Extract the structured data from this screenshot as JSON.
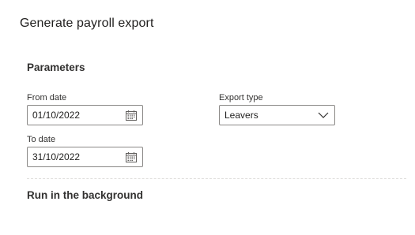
{
  "dialog": {
    "title": "Generate payroll export"
  },
  "parameters": {
    "section_title": "Parameters",
    "from_date": {
      "label": "From date",
      "value": "01/10/2022",
      "icon": "calendar-icon"
    },
    "to_date": {
      "label": "To date",
      "value": "31/10/2022",
      "icon": "calendar-icon"
    },
    "export_type": {
      "label": "Export type",
      "value": "Leavers",
      "icon": "chevron-down-icon"
    }
  },
  "background": {
    "section_title": "Run in the background"
  },
  "colors": {
    "border": "#8a8886",
    "text": "#201f1e",
    "divider": "#e1dfdd"
  }
}
